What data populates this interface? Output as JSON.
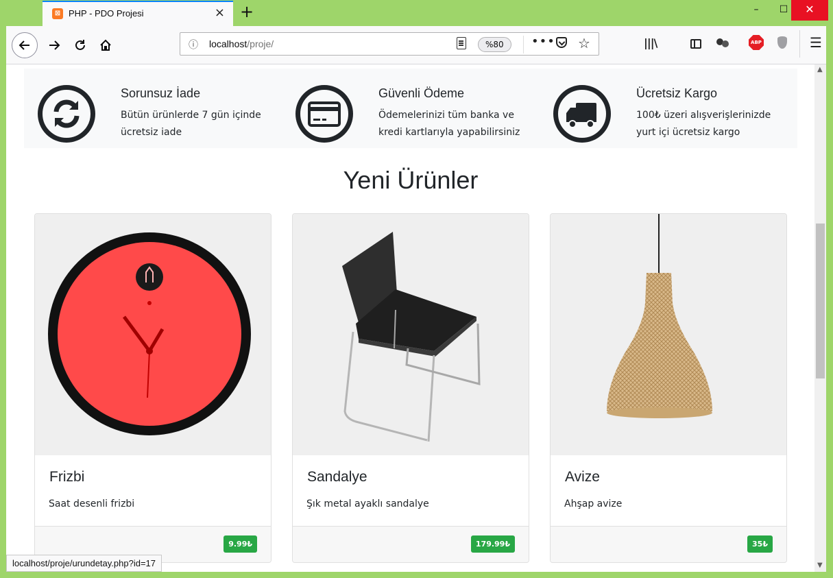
{
  "browser": {
    "tab_title": "PHP - PDO Projesi",
    "tab_close": "×",
    "new_tab": "+",
    "url_host": "localhost",
    "url_path": "/proje/",
    "zoom": "%80",
    "more": "•••",
    "status_url": "localhost/proje/urundetay.php?id=17",
    "abp_label": "ABP",
    "window_controls": {
      "minimize": "–",
      "maximize": "☐",
      "close": "✕"
    }
  },
  "features": [
    {
      "icon": "refresh-icon",
      "title": "Sorunsuz İade",
      "text": "Bütün ürünlerde 7 gün içinde ücretsiz iade"
    },
    {
      "icon": "credit-card-icon",
      "title": "Güvenli Ödeme",
      "text": "Ödemelerinizi tüm banka ve kredi kartlarıyla yapabilirsiniz"
    },
    {
      "icon": "truck-icon",
      "title": "Ücretsiz Kargo",
      "text": "100₺ üzeri alışverişlerinizde yurt içi ücretsiz kargo"
    }
  ],
  "section_title": "Yeni Ürünler",
  "products": [
    {
      "name": "Frizbi",
      "description": "Saat desenli frizbi",
      "price": "9.99₺",
      "image": "clock-frisbee-image"
    },
    {
      "name": "Sandalye",
      "description": "Şık metal ayaklı sandalye",
      "price": "179.99₺",
      "image": "chair-image"
    },
    {
      "name": "Avize",
      "description": "Ahşap avize",
      "price": "35₺",
      "image": "pendant-lamp-image"
    }
  ],
  "colors": {
    "accent_badge": "#28a745",
    "tab_highlight": "#0a84ff",
    "window_frame": "#9ed56a"
  }
}
